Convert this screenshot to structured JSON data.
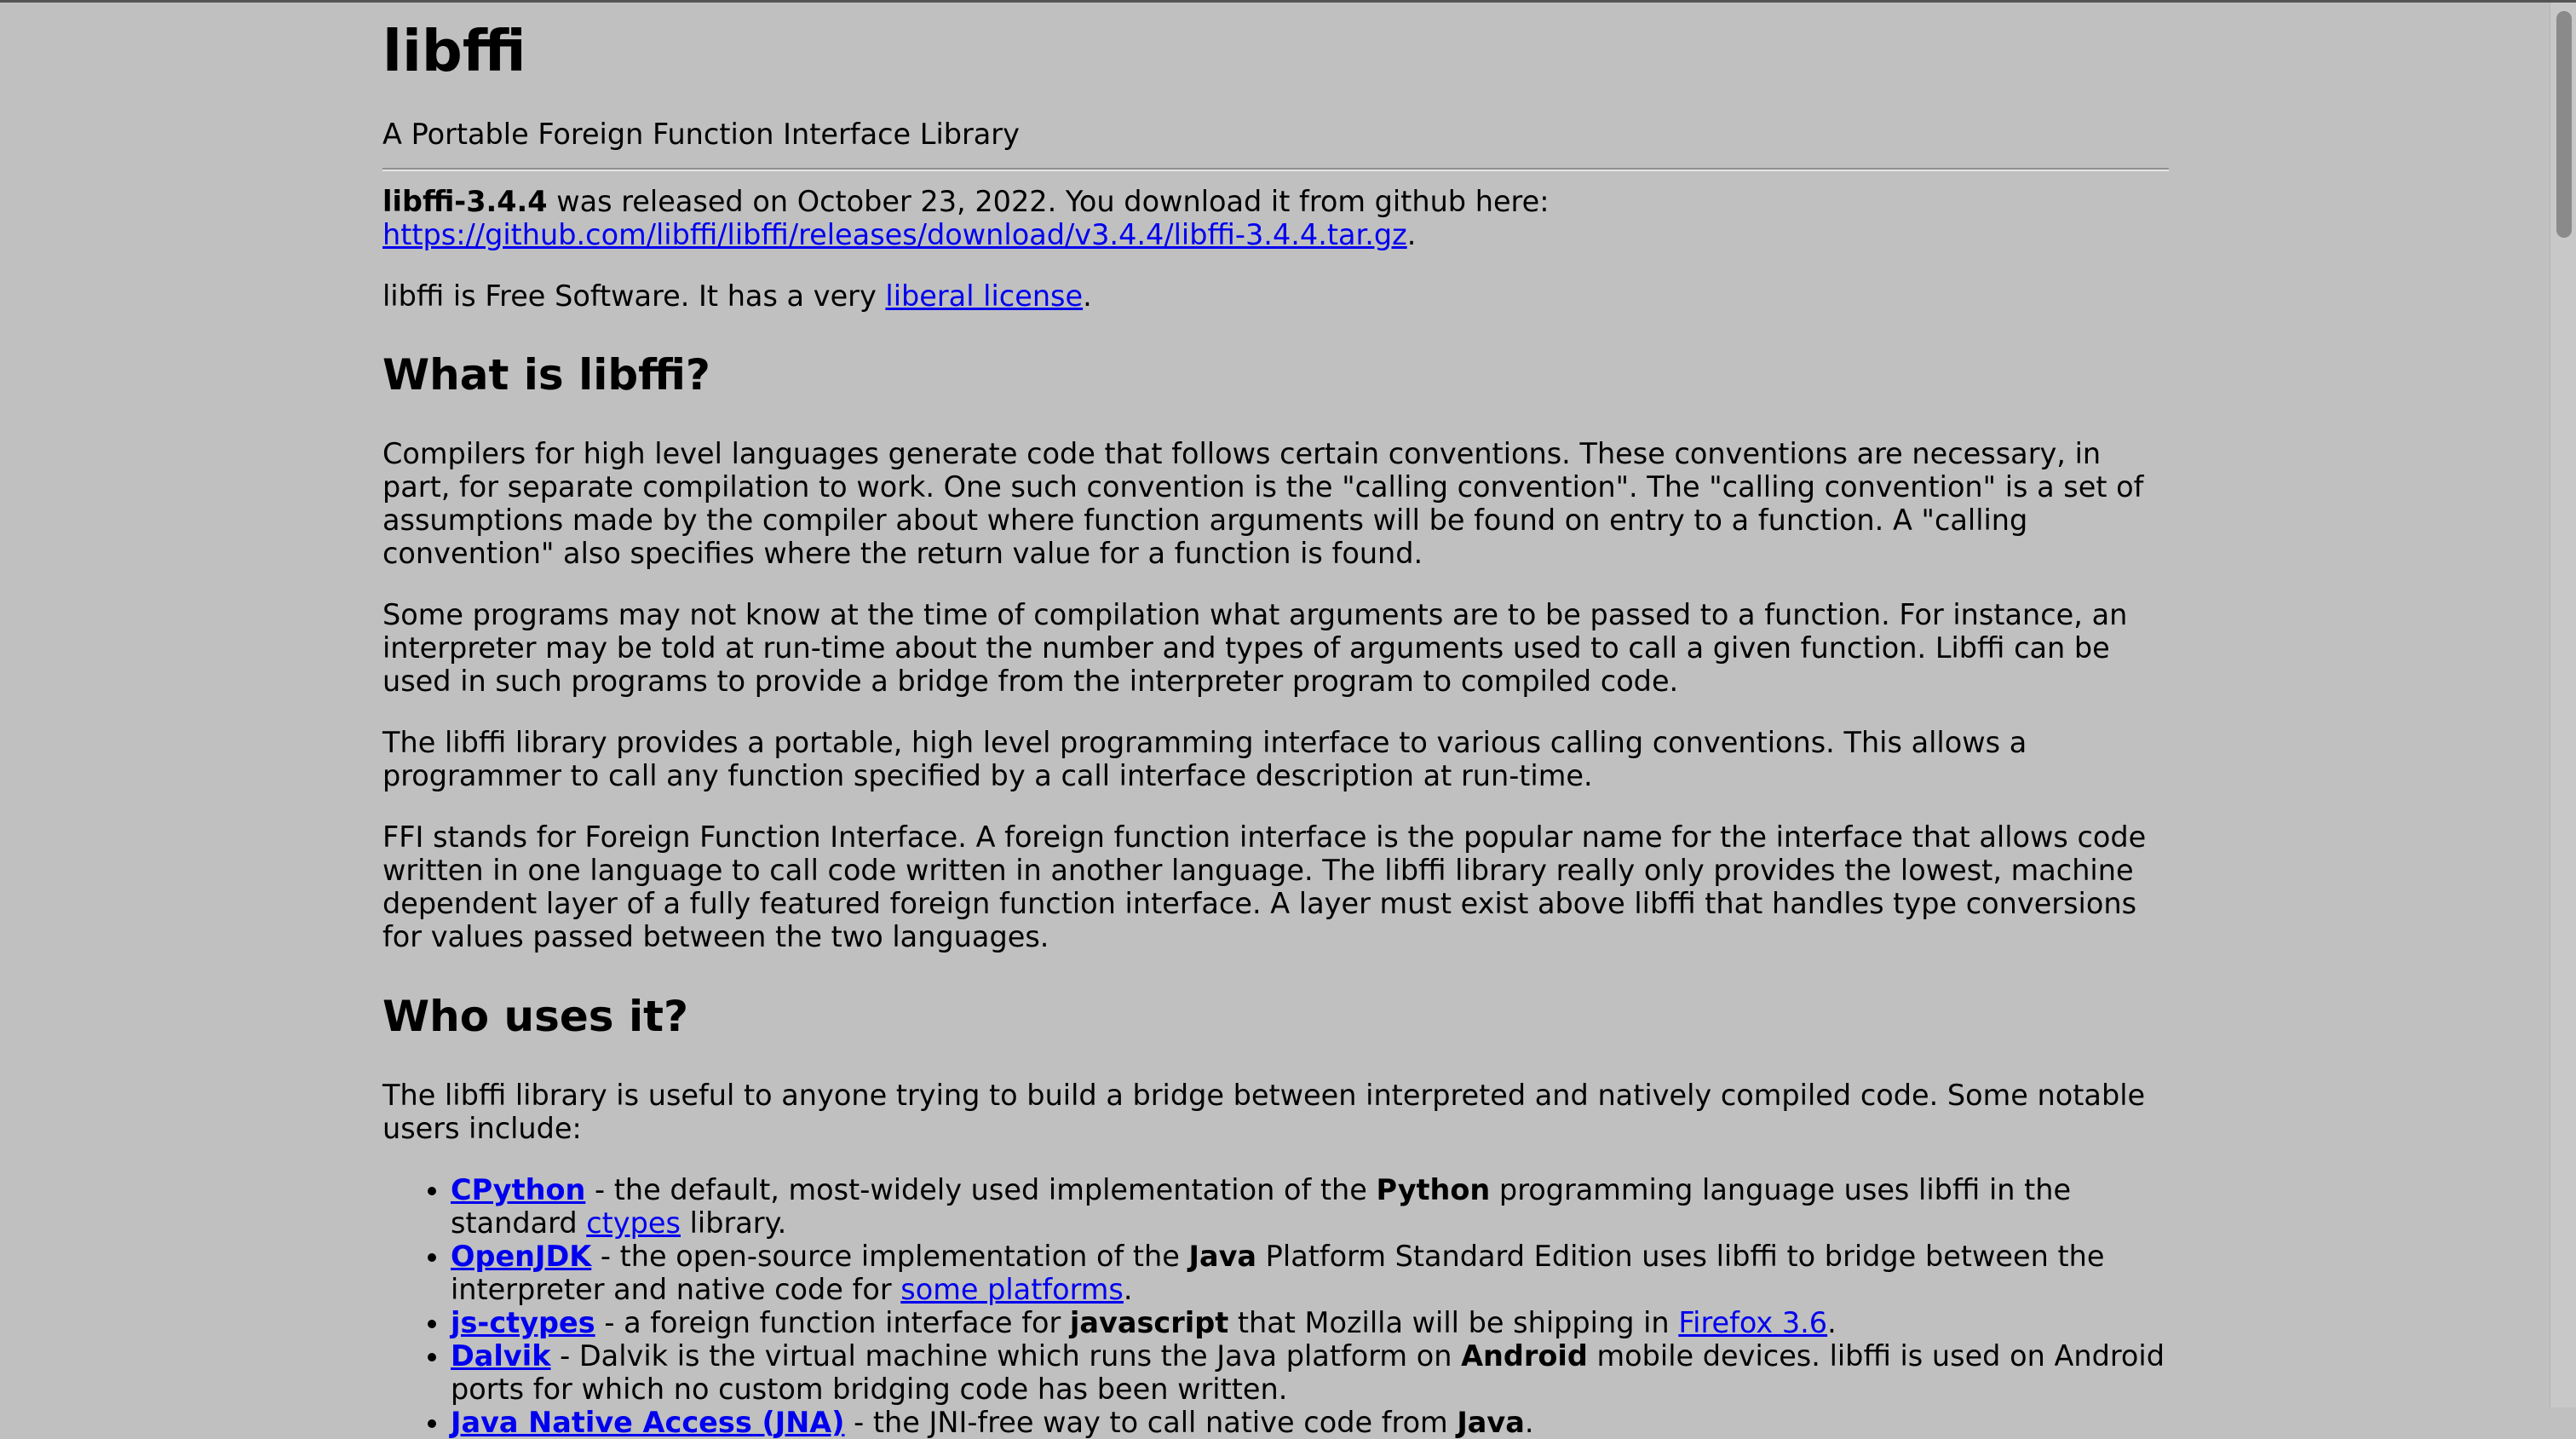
{
  "page": {
    "title": "libffi",
    "subtitle": "A Portable Foreign Function Interface Library",
    "release": {
      "version": "libffi-3.4.4",
      "text": " was released on October 23, 2022. You download it from github here:",
      "link": "https://github.com/libffi/libffi/releases/download/v3.4.4/libffi-3.4.4.tar.gz",
      "after_link": "."
    },
    "license": {
      "before": "libffi is Free Software. It has a very ",
      "link": "liberal license",
      "after": "."
    },
    "what": {
      "heading": "What is libffi?",
      "paragraphs": [
        "Compilers for high level languages generate code that follows certain conventions. These conventions are necessary, in part, for separate compilation to work. One such convention is the \"calling convention\". The \"calling convention\" is a set of assumptions made by the compiler about where function arguments will be found on entry to a function. A \"calling convention\" also specifies where the return value for a function is found.",
        "Some programs may not know at the time of compilation what arguments are to be passed to a function. For instance, an interpreter may be told at run-time about the number and types of arguments used to call a given function. Libffi can be used in such programs to provide a bridge from the interpreter program to compiled code.",
        "The libffi library provides a portable, high level programming interface to various calling conventions. This allows a programmer to call any function specified by a call interface description at run-time.",
        "FFI stands for Foreign Function Interface. A foreign function interface is the popular name for the interface that allows code written in one language to call code written in another language. The libffi library really only provides the lowest, machine dependent layer of a fully featured foreign function interface. A layer must exist above libffi that handles type conversions for values passed between the two languages."
      ]
    },
    "who": {
      "heading": "Who uses it?",
      "intro": "The libffi library is useful to anyone trying to build a bridge between interpreted and natively compiled code. Some notable users include:",
      "users": [
        {
          "name": "CPython",
          "t1": " - the default, most-widely used implementation of the ",
          "bold": "Python",
          "t2": " programming language uses libffi in the standard ",
          "link2": "ctypes",
          "t3": " library."
        },
        {
          "name": "OpenJDK",
          "t1": " - the open-source implementation of the ",
          "bold": "Java",
          "t2": " Platform Standard Edition uses libffi to bridge between the interpreter and native code for ",
          "link2": "some platforms",
          "t3": "."
        },
        {
          "name": "js-ctypes",
          "t1": " - a foreign function interface for ",
          "bold": "javascript",
          "t2": " that Mozilla will be shipping in ",
          "link2": "Firefox 3.6",
          "t3": "."
        },
        {
          "name": "Dalvik",
          "t1": " - Dalvik is the virtual machine which runs the Java platform on ",
          "bold": "Android",
          "t2": " mobile devices. libffi is used on Android ports for which no custom bridging code has been written.",
          "link2": "",
          "t3": ""
        },
        {
          "name": "Java Native Access (JNA)",
          "t1": " - the JNI-free way to call native code from ",
          "bold": "Java",
          "t2": ".",
          "link2": "",
          "t3": ""
        }
      ]
    }
  }
}
